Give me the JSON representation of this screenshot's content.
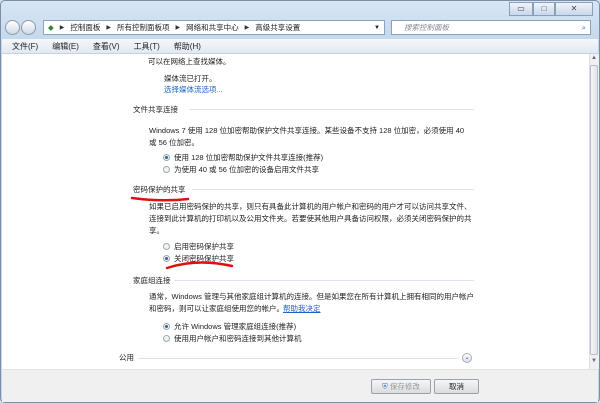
{
  "window": {
    "controls": [
      "minimize",
      "maximize",
      "close"
    ]
  },
  "address": {
    "crumbs": [
      "控制面板",
      "所有控制面板项",
      "网络和共享中心",
      "高级共享设置"
    ],
    "search_placeholder": "搜索控制面板"
  },
  "menu": [
    "文件(F)",
    "编辑(E)",
    "查看(V)",
    "工具(T)",
    "帮助(H)"
  ],
  "media": {
    "line1": "可以在网络上查找媒体。",
    "status": "媒体流已打开。",
    "link": "选择媒体流选项..."
  },
  "file_sharing": {
    "title": "文件共享连接",
    "desc1": "Windows 7 使用 128 位加密帮助保护文件共享连接。某些设备不支持 128 位加密，必须使用 40",
    "desc2": "或 56 位加密。",
    "options": [
      {
        "label": "使用 128 位加密帮助保护文件共享连接(推荐)",
        "selected": true
      },
      {
        "label": "为使用 40 或 56 位加密的设备启用文件共享",
        "selected": false
      }
    ]
  },
  "password": {
    "title": "密码保护的共享",
    "desc1": "如果已启用密码保护的共享，则只有具备此计算机的用户帐户和密码的用户才可以访问共享文件、",
    "desc2": "连接到此计算机的打印机以及公用文件夹。若要使其他用户具备访问权限，必须关闭密码保护的共",
    "desc3": "享。",
    "options": [
      {
        "label": "启用密码保护共享",
        "selected": false
      },
      {
        "label": "关闭密码保护共享",
        "selected": true
      }
    ]
  },
  "homegroup": {
    "title": "家庭组连接",
    "desc1": "通常，Windows 管理与其他家庭组计算机的连接。但是如果您在所有计算机上拥有相同的用户帐户",
    "desc2": "和密码，则可以让家庭组使用您的帐户。",
    "link": "帮助我决定",
    "options": [
      {
        "label": "允许 Windows 管理家庭组连接(推荐)",
        "selected": true
      },
      {
        "label": "使用用户帐户和密码连接到其他计算机",
        "selected": false
      }
    ]
  },
  "public": {
    "title": "公用"
  },
  "footer": {
    "save": "保存修改",
    "cancel": "取消"
  },
  "annotation_color": "#e01010"
}
